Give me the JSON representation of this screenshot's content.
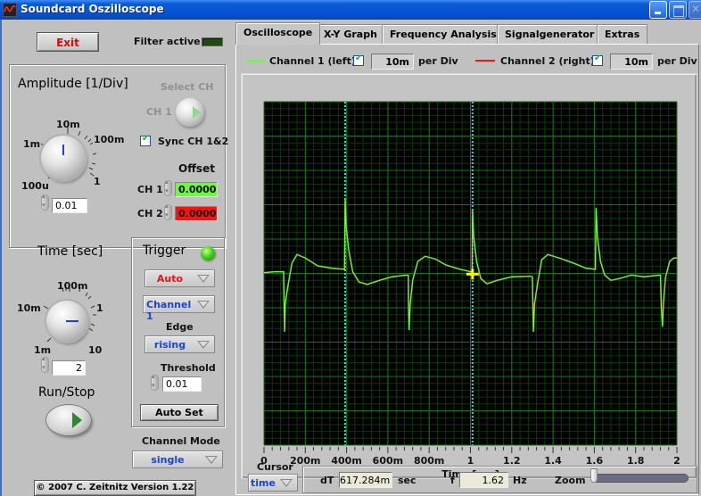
{
  "window": {
    "title": "Soundcard Oszilloscope",
    "controls": [
      "minimize",
      "maximize",
      "close"
    ]
  },
  "left_panel": {
    "exit_label": "Exit",
    "filter_label": "Filter active",
    "filter_active": false,
    "amplitude": {
      "title": "Amplitude [1/Div]",
      "dial_labels": [
        "100u",
        "1m",
        "10m",
        "100m",
        "1"
      ],
      "value": "0.01"
    },
    "select_ch": {
      "title": "Select CH",
      "value": "CH 1"
    },
    "sync": {
      "label": "Sync CH 1&2",
      "checked": true
    },
    "offset": {
      "title": "Offset",
      "channels": [
        {
          "label": "CH 1",
          "value": "0.0000",
          "color": "#66ff33"
        },
        {
          "label": "CH 2",
          "value": "0.0000",
          "color": "#ff1010"
        }
      ]
    },
    "time": {
      "title": "Time [sec]",
      "dial_labels": [
        "1m",
        "10m",
        "100m",
        "1",
        "10"
      ],
      "value": "2"
    },
    "trigger": {
      "title": "Trigger",
      "led_on": true,
      "mode": "Auto",
      "source": "Channel 1",
      "edge_label": "Edge",
      "edge": "rising",
      "threshold_label": "Threshold",
      "threshold": "0.01",
      "autoset_label": "Auto Set"
    },
    "run_stop_label": "Run/Stop",
    "channel_mode": {
      "label": "Channel Mode",
      "value": "single"
    },
    "copyright": "© 2007   C. Zeitnitz Version 1.22"
  },
  "tabs": [
    {
      "label": "Oscilloscope",
      "active": true
    },
    {
      "label": "X-Y Graph",
      "active": false
    },
    {
      "label": "Frequency Analysis",
      "active": false
    },
    {
      "label": "Signalgenerator",
      "active": false
    },
    {
      "label": "Extras",
      "active": false
    }
  ],
  "channel_bar": {
    "ch1": {
      "label": "Channel 1 (left)",
      "enabled": true,
      "per_div": "10m",
      "per_div_label": "per Div",
      "color": "#66ff33"
    },
    "ch2": {
      "label": "Channel 2 (right)",
      "enabled": true,
      "per_div": "10m",
      "per_div_label": "per Div",
      "color": "#ff1010"
    }
  },
  "cursor_bar": {
    "cursor_label": "Cursor",
    "cursor_mode": "time",
    "dT_label": "dT",
    "dT_value": "617.284m",
    "dT_unit": "sec",
    "f_label": "f",
    "f_value": "1.62",
    "f_unit": "Hz",
    "zoom_label": "Zoom",
    "zoom_level": 0
  },
  "chart_data": {
    "type": "line",
    "title": "",
    "xlabel": "Time [sec]",
    "ylabel": "",
    "xlim": [
      0,
      2
    ],
    "ylim_divisions": [
      -5,
      5
    ],
    "y_units": "divisions (10m per Div)",
    "grid": true,
    "x_ticks": [
      {
        "value": 0,
        "label": "0"
      },
      {
        "value": 0.2,
        "label": "200m"
      },
      {
        "value": 0.4,
        "label": "400m"
      },
      {
        "value": 0.6,
        "label": "600m"
      },
      {
        "value": 0.8,
        "label": "800m"
      },
      {
        "value": 1.0,
        "label": "1"
      },
      {
        "value": 1.2,
        "label": "1.2"
      },
      {
        "value": 1.4,
        "label": "1.4"
      },
      {
        "value": 1.6,
        "label": "1.6"
      },
      {
        "value": 1.8,
        "label": "1.8"
      },
      {
        "value": 2.0,
        "label": "2"
      }
    ],
    "cursors": [
      {
        "name": "cursor-1",
        "x": 0.393,
        "color": "#22e0e0"
      },
      {
        "name": "cursor-2",
        "x": 1.01,
        "color": "#22e0e0",
        "marker_y": -0.02
      }
    ],
    "series": [
      {
        "name": "Channel 1 (left)",
        "color": "#66ff33",
        "points": [
          [
            0.0,
            0.02
          ],
          [
            0.05,
            0.05
          ],
          [
            0.095,
            0.05
          ],
          [
            0.097,
            -0.8
          ],
          [
            0.1,
            -1.7
          ],
          [
            0.103,
            -0.9
          ],
          [
            0.115,
            -0.4
          ],
          [
            0.135,
            0.3
          ],
          [
            0.16,
            0.55
          ],
          [
            0.2,
            0.45
          ],
          [
            0.26,
            0.22
          ],
          [
            0.33,
            0.15
          ],
          [
            0.39,
            0.12
          ],
          [
            0.393,
            2.15
          ],
          [
            0.398,
            1.4
          ],
          [
            0.41,
            0.7
          ],
          [
            0.43,
            0.05
          ],
          [
            0.46,
            -0.25
          ],
          [
            0.5,
            -0.32
          ],
          [
            0.56,
            -0.2
          ],
          [
            0.62,
            -0.1
          ],
          [
            0.69,
            -0.05
          ],
          [
            0.699,
            -0.05
          ],
          [
            0.7,
            -0.9
          ],
          [
            0.703,
            -1.65
          ],
          [
            0.708,
            -0.9
          ],
          [
            0.72,
            -0.2
          ],
          [
            0.745,
            0.35
          ],
          [
            0.78,
            0.5
          ],
          [
            0.83,
            0.42
          ],
          [
            0.88,
            0.25
          ],
          [
            0.95,
            0.12
          ],
          [
            1.0,
            0.05
          ],
          [
            1.008,
            0.05
          ],
          [
            1.01,
            1.85
          ],
          [
            1.015,
            1.1
          ],
          [
            1.03,
            0.35
          ],
          [
            1.05,
            -0.15
          ],
          [
            1.08,
            -0.3
          ],
          [
            1.13,
            -0.2
          ],
          [
            1.2,
            -0.1
          ],
          [
            1.29,
            -0.08
          ],
          [
            1.3,
            -0.1
          ],
          [
            1.302,
            -0.8
          ],
          [
            1.305,
            -1.7
          ],
          [
            1.31,
            -0.9
          ],
          [
            1.325,
            -0.3
          ],
          [
            1.345,
            0.4
          ],
          [
            1.375,
            0.55
          ],
          [
            1.43,
            0.45
          ],
          [
            1.5,
            0.3
          ],
          [
            1.56,
            0.15
          ],
          [
            1.605,
            0.12
          ],
          [
            1.608,
            1.9
          ],
          [
            1.615,
            1.05
          ],
          [
            1.63,
            0.35
          ],
          [
            1.65,
            -0.05
          ],
          [
            1.68,
            -0.2
          ],
          [
            1.72,
            -0.15
          ],
          [
            1.78,
            -0.05
          ],
          [
            1.84,
            -0.1
          ],
          [
            1.92,
            -0.05
          ],
          [
            1.925,
            -1.0
          ],
          [
            1.93,
            -1.55
          ],
          [
            1.935,
            -0.8
          ],
          [
            1.945,
            -0.1
          ],
          [
            1.965,
            0.35
          ],
          [
            1.985,
            0.45
          ],
          [
            2.0,
            0.45
          ]
        ]
      }
    ]
  }
}
